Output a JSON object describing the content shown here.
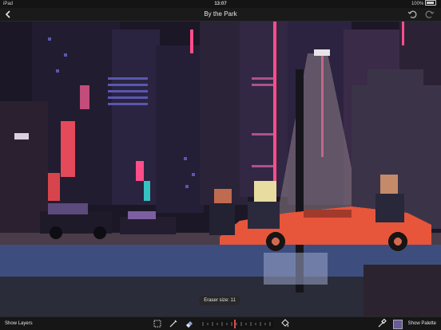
{
  "status_bar": {
    "device": "iPad",
    "time": "13:07",
    "battery": "100%"
  },
  "navbar": {
    "title": "By the Park",
    "back_icon": "chevron-left-icon",
    "undo_icon": "undo-icon",
    "redo_icon": "redo-icon"
  },
  "canvas": {
    "description_colors": {
      "sky": "#1b1726",
      "road": "#3d4e7e",
      "car": "#e7553b",
      "neon_pink": "#ff4d8a"
    }
  },
  "tooltip": {
    "eraser_size_label": "Eraser size: 11"
  },
  "toolbar": {
    "show_layers": "Show Layers",
    "show_palette": "Show Palette",
    "tools": [
      "selection-icon",
      "pencil-icon",
      "eraser-icon",
      "fill-bucket-icon",
      "eyedropper-icon"
    ],
    "current_color": "#6a5a9a"
  }
}
